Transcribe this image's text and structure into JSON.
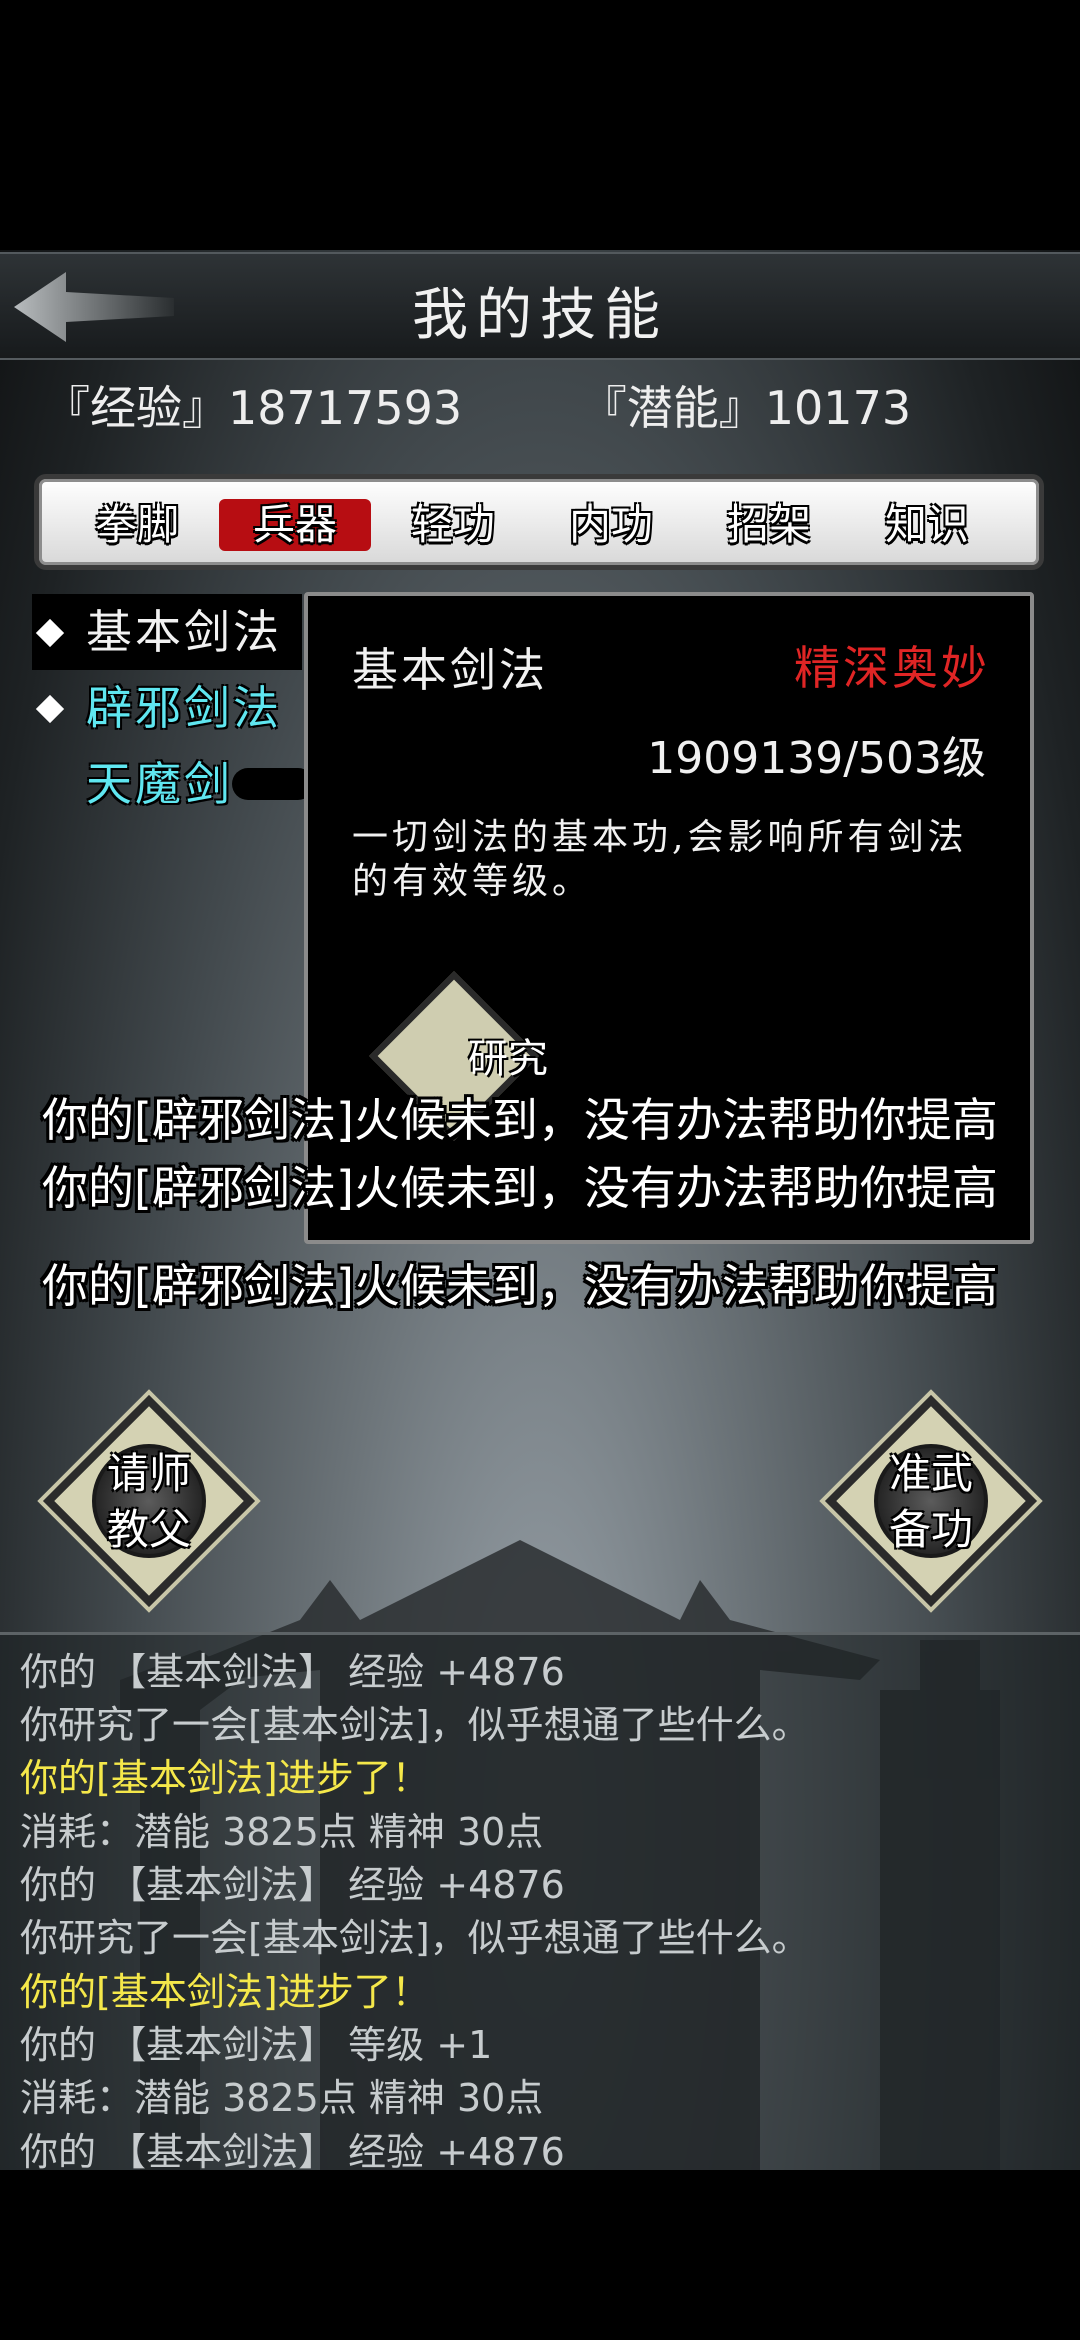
{
  "header": {
    "title": "我的技能",
    "back_icon": "back-arrow-icon"
  },
  "stats": {
    "experience": "『经验』18717593",
    "potential": "『潜能』10173"
  },
  "tabs": [
    {
      "label": "拳脚",
      "active": false
    },
    {
      "label": "兵器",
      "active": true
    },
    {
      "label": "轻功",
      "active": false
    },
    {
      "label": "内功",
      "active": false
    },
    {
      "label": "招架",
      "active": false
    },
    {
      "label": "知识",
      "active": false
    }
  ],
  "skills": [
    {
      "label": "基本剑法",
      "selected": true
    },
    {
      "label": "辟邪剑法",
      "selected": false
    },
    {
      "label": "天魔剑",
      "selected": false
    }
  ],
  "detail": {
    "name": "基本剑法",
    "rank": "精深奥妙",
    "level": "1909139/503级",
    "description": "一切剑法的基本功,会影响所有剑法的有效等级。",
    "button_label": "研究"
  },
  "floating_messages": [
    "你的[辟邪剑法]火候未到，没有办法帮助你提高",
    "你的[辟邪剑法]火候未到，没有办法帮助你提高",
    "你的[辟邪剑法]火候未到，没有办法帮助你提高"
  ],
  "buttons": {
    "master": {
      "line1": "请师",
      "line2": "教父"
    },
    "prepare": {
      "line1": "准武",
      "line2": "备功"
    }
  },
  "log": [
    {
      "text": "你的 【基本剑法】 经验 +4876",
      "highlight": false
    },
    {
      "text": "你研究了一会[基本剑法]，似乎想通了些什么。",
      "highlight": false
    },
    {
      "text": "你的[基本剑法]进步了！",
      "highlight": true
    },
    {
      "text": "消耗：潜能 3825点  精神 30点",
      "highlight": false
    },
    {
      "text": "你的 【基本剑法】 经验 +4876",
      "highlight": false
    },
    {
      "text": "你研究了一会[基本剑法]，似乎想通了些什么。",
      "highlight": false
    },
    {
      "text": "你的[基本剑法]进步了！",
      "highlight": true
    },
    {
      "text": "你的 【基本剑法】 等级 +1",
      "highlight": false
    },
    {
      "text": "消耗：潜能 3825点  精神 30点",
      "highlight": false
    },
    {
      "text": "你的 【基本剑法】 经验 +4876",
      "highlight": false
    }
  ],
  "colors": {
    "active_tab": "#b70d12",
    "rank": "#e02525",
    "highlight_log": "#f5e84a",
    "skill_cyan": "#5fe6f0"
  }
}
